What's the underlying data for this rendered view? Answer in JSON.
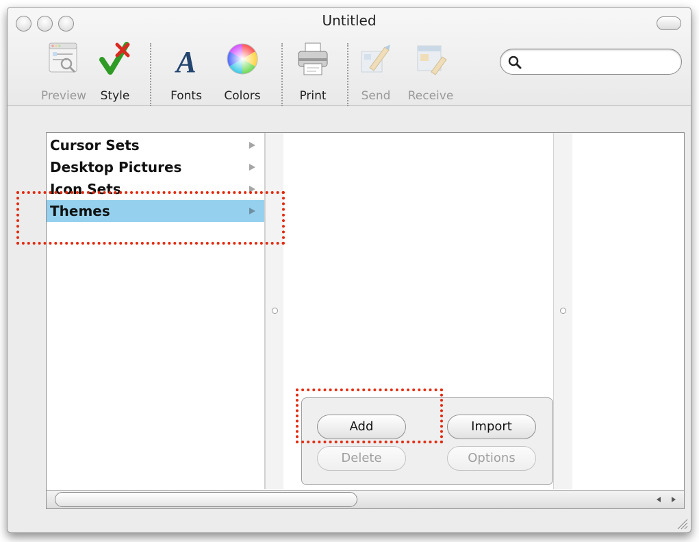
{
  "window": {
    "title": "Untitled"
  },
  "toolbar": {
    "items": [
      {
        "label": "Preview",
        "icon": "preview-icon",
        "enabled": false
      },
      {
        "label": "Style",
        "icon": "style-icon",
        "enabled": true
      },
      {
        "label": "Fonts",
        "icon": "fonts-icon",
        "enabled": true
      },
      {
        "label": "Colors",
        "icon": "colors-icon",
        "enabled": true
      },
      {
        "label": "Print",
        "icon": "print-icon",
        "enabled": true
      },
      {
        "label": "Send",
        "icon": "send-icon",
        "enabled": false
      },
      {
        "label": "Receive",
        "icon": "receive-icon",
        "enabled": false
      }
    ],
    "search": {
      "value": "",
      "placeholder": ""
    }
  },
  "browser": {
    "column1": {
      "items": [
        {
          "label": "Cursor Sets",
          "selected": false
        },
        {
          "label": "Desktop Pictures",
          "selected": false
        },
        {
          "label": "Icon Sets",
          "selected": false
        },
        {
          "label": "Themes",
          "selected": true
        }
      ]
    }
  },
  "buttons": {
    "add": {
      "label": "Add",
      "enabled": true
    },
    "import": {
      "label": "Import",
      "enabled": true
    },
    "delete": {
      "label": "Delete",
      "enabled": false
    },
    "options": {
      "label": "Options",
      "enabled": false
    }
  },
  "colors": {
    "selection": "#95d1ef",
    "annotation": "#e22a0f"
  }
}
